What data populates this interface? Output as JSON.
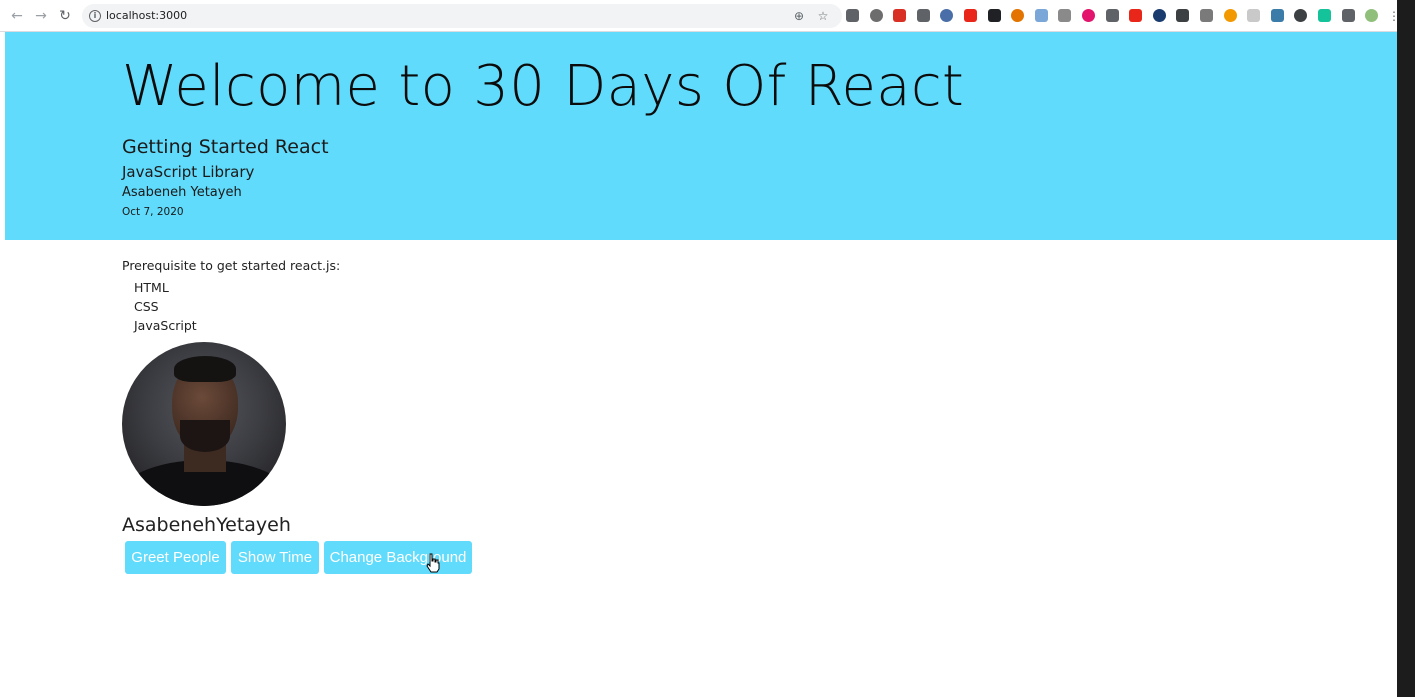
{
  "browser": {
    "url": "localhost:3000",
    "back_icon": "←",
    "forward_icon": "→",
    "reload_icon": "↻",
    "info_icon": "i",
    "zoom_icon": "⊕",
    "star_icon": "☆",
    "menu_icon": "⋮",
    "extensions": [
      {
        "name": "ext-1-icon",
        "color": "#5f6368"
      },
      {
        "name": "ext-2-icon",
        "color": "#6d6d6d"
      },
      {
        "name": "ext-3-icon",
        "color": "#d93025"
      },
      {
        "name": "ext-4-icon",
        "color": "#5f6368"
      },
      {
        "name": "ext-5-icon",
        "color": "#4a6ea8"
      },
      {
        "name": "ext-6-icon",
        "color": "#e8271a"
      },
      {
        "name": "ext-7-icon",
        "color": "#202124"
      },
      {
        "name": "ext-8-icon",
        "color": "#e37400"
      },
      {
        "name": "ext-9-icon",
        "color": "#7aa7d8"
      },
      {
        "name": "ext-10-icon",
        "color": "#8a8a8a"
      },
      {
        "name": "ext-11-icon",
        "color": "#e2146e"
      },
      {
        "name": "ext-12-icon",
        "color": "#5f6368"
      },
      {
        "name": "ext-13-icon",
        "color": "#e8271a"
      },
      {
        "name": "ext-14-icon",
        "color": "#1a3b6e"
      },
      {
        "name": "ext-15-icon",
        "color": "#3c4043"
      },
      {
        "name": "ext-16-icon",
        "color": "#7a7a7a"
      },
      {
        "name": "ext-17-icon",
        "color": "#f29900"
      },
      {
        "name": "ext-18-icon",
        "color": "#c9c9c9"
      },
      {
        "name": "ext-19-icon",
        "color": "#3c7ca8"
      },
      {
        "name": "ext-20-icon",
        "color": "#3c4043"
      },
      {
        "name": "ext-21-icon",
        "color": "#15c39a"
      },
      {
        "name": "ext-22-icon",
        "color": "#5f6368"
      },
      {
        "name": "ext-23-icon",
        "color": "#8fbf7a"
      }
    ]
  },
  "header": {
    "title": "Welcome to 30 Days Of React",
    "subtitle": "Getting Started React",
    "library": "JavaScript Library",
    "author": "Asabeneh Yetayeh",
    "date": "Oct 7, 2020",
    "background": "#61dbfb"
  },
  "main": {
    "prereq_label": "Prerequisite to get started react.js:",
    "techs": [
      "HTML",
      "CSS",
      "JavaScript"
    ],
    "full_name": "AsabenehYetayeh",
    "buttons": {
      "greet": "Greet People",
      "show_time": "Show Time",
      "change_background": "Change Background"
    }
  }
}
